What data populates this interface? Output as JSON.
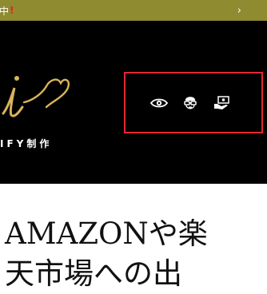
{
  "announcement": {
    "text": "中",
    "exclamation": "!",
    "chevron_icon": "chevron-right-icon"
  },
  "header": {
    "logo_text": "IFY制作",
    "icons": [
      {
        "name": "eye-icon"
      },
      {
        "name": "avatar-glasses-icon"
      },
      {
        "name": "money-hand-icon"
      }
    ],
    "highlight_color": "#e5282e"
  },
  "headline": {
    "line1": "AMAZONや楽",
    "line2": "天市場への出"
  },
  "colors": {
    "announce_bg": "#8e8b31",
    "header_bg": "#000000",
    "logo_gold": "#d9b45a"
  }
}
